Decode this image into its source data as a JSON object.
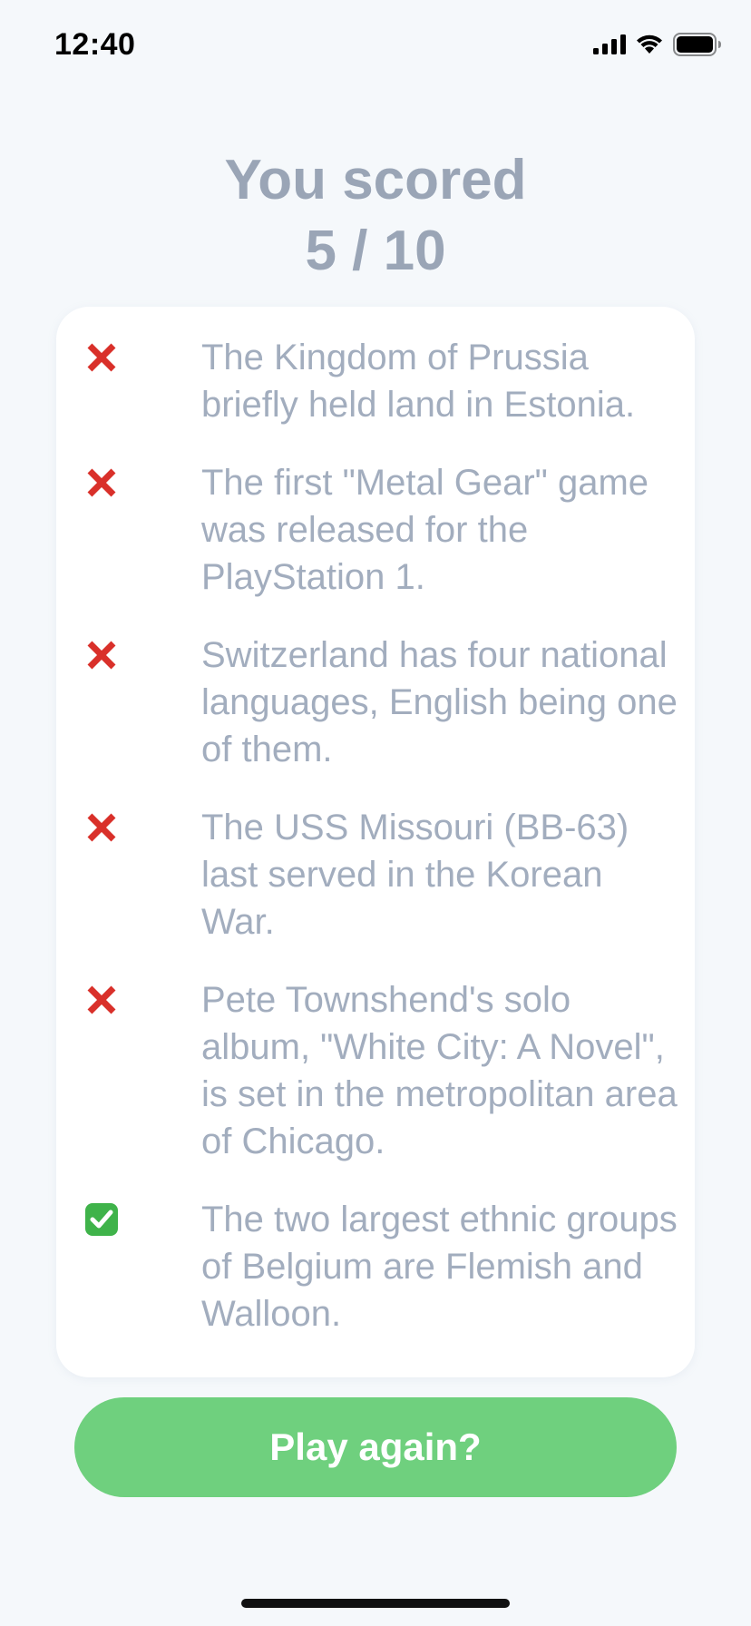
{
  "status_bar": {
    "time": "12:40",
    "icons": [
      "cellular-signal-icon",
      "wifi-icon",
      "battery-icon"
    ]
  },
  "score": {
    "line1": "You scored",
    "line2": "5 / 10"
  },
  "colors": {
    "background": "#f5f8fb",
    "card": "#ffffff",
    "text_muted": "#a2adbe",
    "title": "#9aa5b6",
    "wrong": "#d9302a",
    "correct": "#3fb34a",
    "button": "#6fd07e"
  },
  "results": [
    {
      "status": "incorrect",
      "icon": "cross-mark-icon",
      "text": "The Kingdom of Prussia briefly held land in Estonia."
    },
    {
      "status": "incorrect",
      "icon": "cross-mark-icon",
      "text": "The first \"Metal Gear\" game was released for the PlayStation 1."
    },
    {
      "status": "incorrect",
      "icon": "cross-mark-icon",
      "text": "Switzerland has four national languages, English being one of them."
    },
    {
      "status": "incorrect",
      "icon": "cross-mark-icon",
      "text": "The USS Missouri (BB-63) last served in the Korean War."
    },
    {
      "status": "incorrect",
      "icon": "cross-mark-icon",
      "text": "Pete Townshend's solo album, \"White City: A Novel\", is set in the metropolitan area of Chicago."
    },
    {
      "status": "correct",
      "icon": "check-mark-icon",
      "text": "The two largest ethnic groups of Belgium are Flemish and Walloon."
    }
  ],
  "play_button_label": "Play again?"
}
